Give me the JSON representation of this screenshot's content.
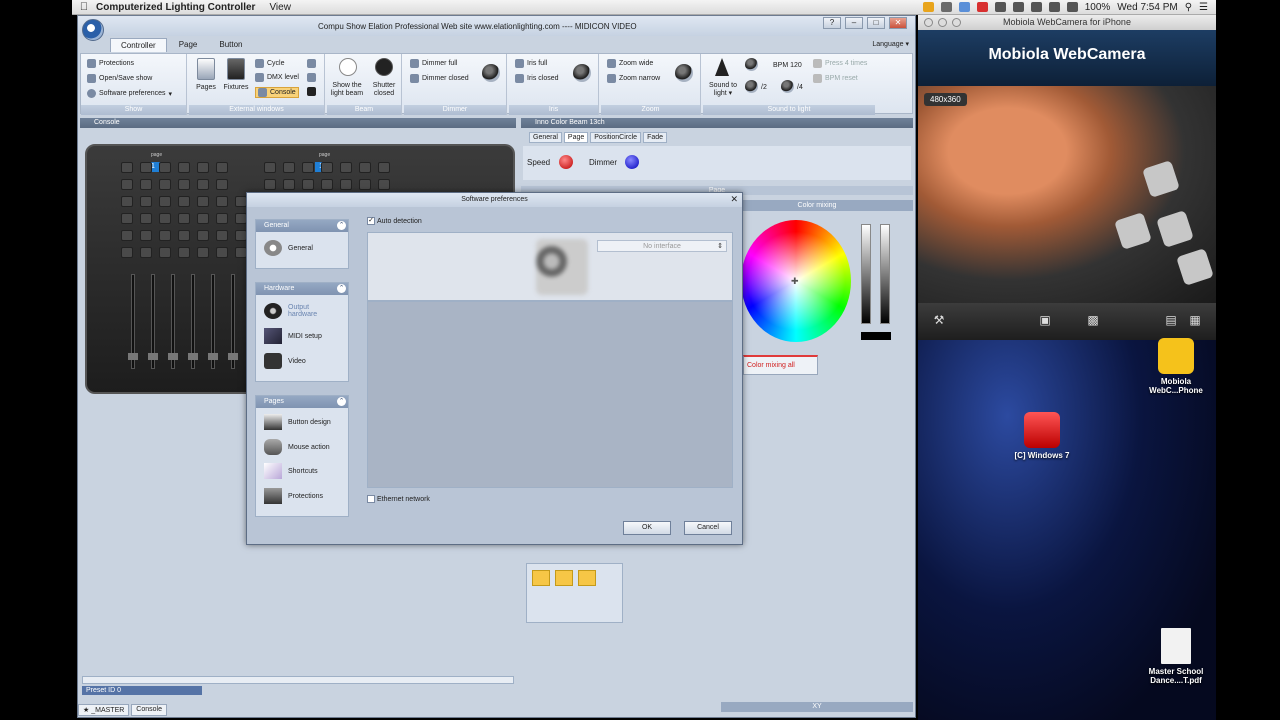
{
  "menubar": {
    "app_name": "Computerized Lighting Controller",
    "menu_view": "View",
    "battery": "100%",
    "clock": "Wed 7:54 PM"
  },
  "app": {
    "title": "Compu Show   Elation Professional   Web site  www.elationlighting.com ---- MIDICON VIDEO",
    "tabs": [
      "Controller",
      "Page",
      "Button"
    ],
    "language": "Language",
    "ribbon": {
      "show": {
        "label": "Show",
        "items": [
          "Protections",
          "Open/Save show",
          "Software preferences"
        ]
      },
      "external": {
        "label": "External windows",
        "pages": "Pages",
        "fixtures": "Fixtures",
        "cycle": "Cycle",
        "dmx_level": "DMX level",
        "console": "Console"
      },
      "beam": {
        "label": "Beam",
        "show_light_beam": "Show the light beam",
        "shutter_closed": "Shutter closed"
      },
      "dimmer": {
        "label": "Dimmer",
        "full": "Dimmer full",
        "closed": "Dimmer closed"
      },
      "iris": {
        "label": "Iris",
        "full": "Iris full",
        "closed": "Iris closed"
      },
      "zoom": {
        "label": "Zoom",
        "wide": "Zoom wide",
        "narrow": "Zoom narrow"
      },
      "sound": {
        "label": "Sound to light",
        "sound_to_light": "Sound to light",
        "bpm": "BPM 120",
        "div2": "/2",
        "div4": "/4",
        "press4": "Press 4 times",
        "bpm_reset": "BPM reset"
      }
    },
    "console_pane": {
      "title": "Console",
      "page_left": "1",
      "page_right": "16",
      "page_label": "page",
      "preset": "Preset ID 0",
      "bottom_tabs": [
        "_MASTER",
        "Console"
      ]
    },
    "inno_pane": {
      "title": "Inno Color Beam 13ch",
      "tabs": [
        "General",
        "Page",
        "PositionCircle",
        "Fade"
      ],
      "speed": "Speed",
      "dimmer": "Dimmer",
      "page_bar": "Page",
      "color_mixing": "Color mixing",
      "color_mixing_all": "Color mixing all",
      "xy": "XY"
    }
  },
  "dialog": {
    "title": "Software preferences",
    "sections": {
      "general": {
        "header": "General",
        "items": [
          "General"
        ]
      },
      "hardware": {
        "header": "Hardware",
        "items": [
          "Output hardware",
          "MIDI setup",
          "Video"
        ]
      },
      "pages": {
        "header": "Pages",
        "items": [
          "Button design",
          "Mouse action",
          "Shortcuts",
          "Protections"
        ]
      }
    },
    "auto_detection": "Auto detection",
    "interface_select": "No interface",
    "ethernet_network": "Ethernet network",
    "ok": "OK",
    "cancel": "Cancel"
  },
  "webcam": {
    "window_title": "Mobiola WebCamera for iPhone",
    "brand": "Mobiola WebCamera",
    "resolution": "480x360"
  },
  "desktop": {
    "icons": [
      {
        "label": "Mobiola WebC...Phone"
      },
      {
        "label": "[C] Windows 7"
      },
      {
        "label": "Master School Dance....T.pdf"
      }
    ]
  }
}
